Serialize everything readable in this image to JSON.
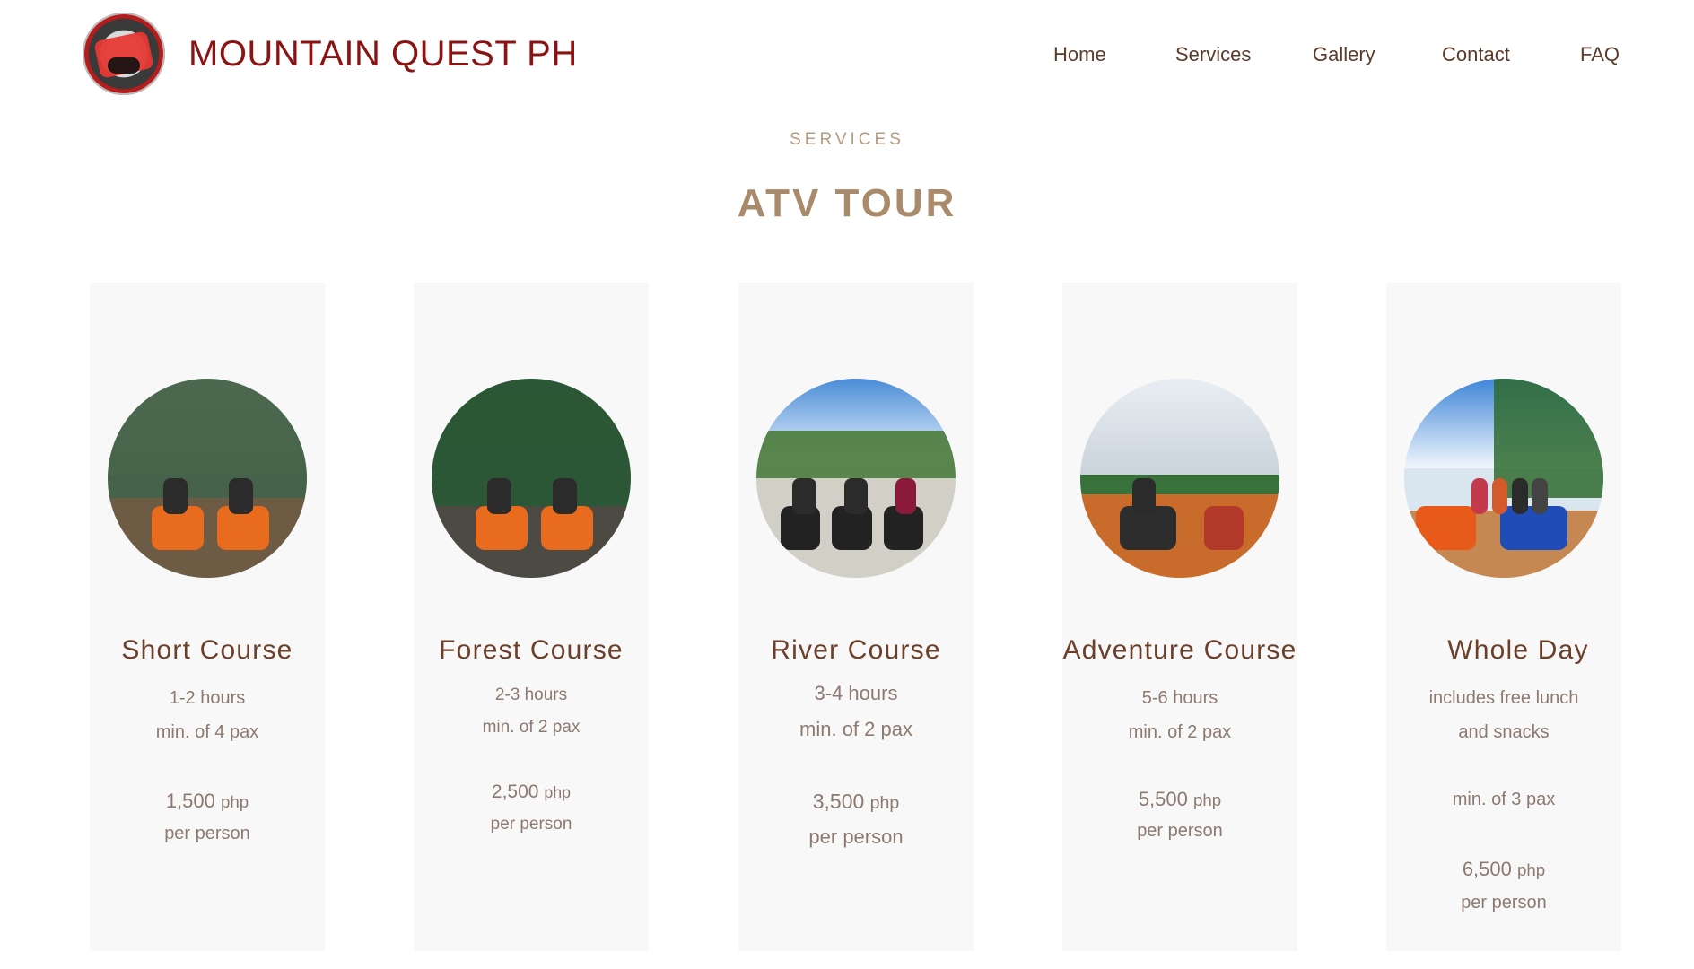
{
  "header": {
    "brand": "MOUNTAIN QUEST PH",
    "nav": [
      "Home",
      "Services",
      "Gallery",
      "Contact",
      "FAQ"
    ]
  },
  "section": {
    "eyebrow": "SERVICES",
    "title": "ATV TOUR"
  },
  "cards": [
    {
      "title": "Short Course",
      "line1": "1-2 hours",
      "line2": "min. of 4 pax",
      "price_number": "1,500",
      "price_unit": "php",
      "per": "per person"
    },
    {
      "title": "Forest Course",
      "line1": "2-3 hours",
      "line2": "min. of 2 pax",
      "price_number": "2,500",
      "price_unit": "php",
      "per": "per person"
    },
    {
      "title": "River Course",
      "line1": "3-4 hours",
      "line2": "min. of 2 pax",
      "price_number": "3,500",
      "price_unit": "php",
      "per": "per person"
    },
    {
      "title": "Adventure Course",
      "line1": "5-6 hours",
      "line2": "min. of 2 pax",
      "price_number": "5,500",
      "price_unit": "php",
      "per": "per person"
    },
    {
      "title": "Whole Day",
      "line1": "includes free lunch",
      "line2": "and snacks",
      "line3": "min. of 3 pax",
      "price_number": "6,500",
      "price_unit": "php",
      "per": "per person"
    }
  ]
}
